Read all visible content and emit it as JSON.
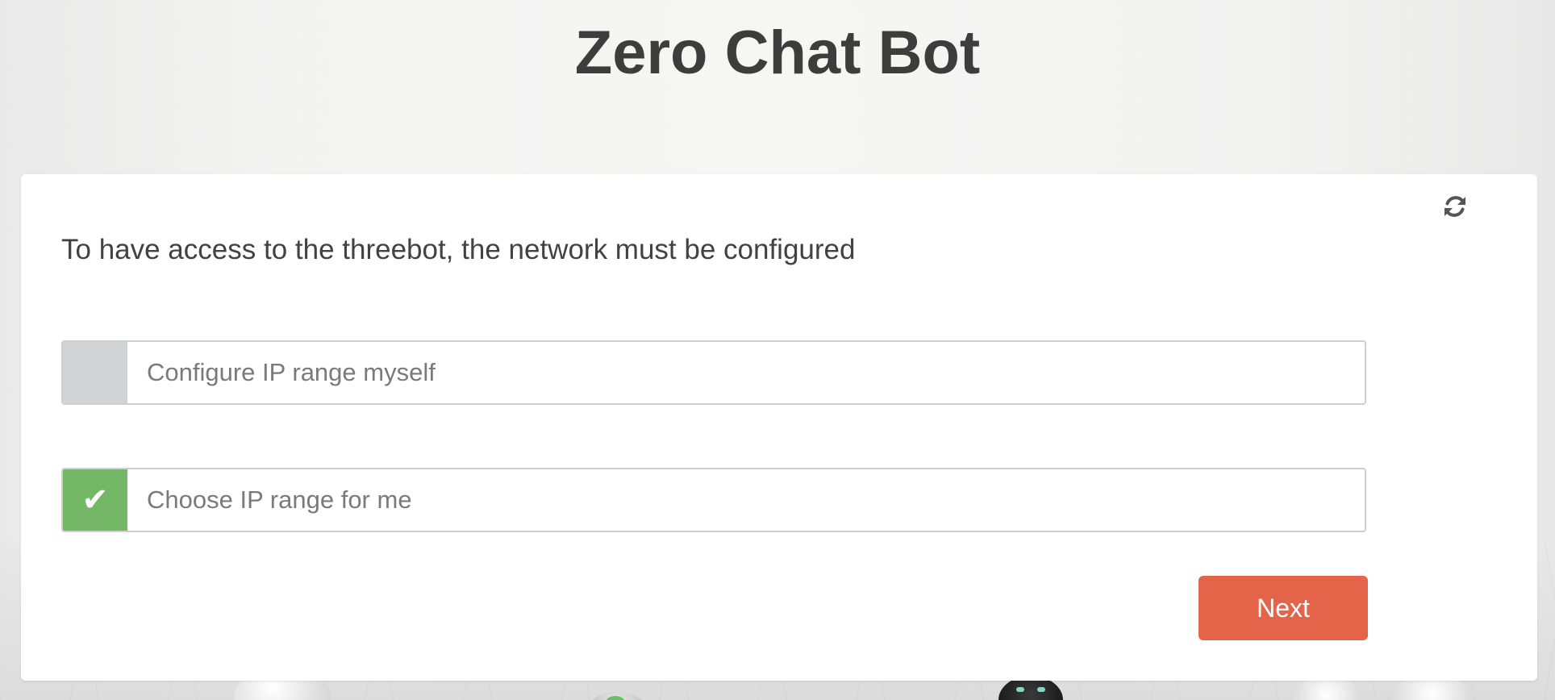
{
  "page": {
    "title": "Zero Chat Bot"
  },
  "card": {
    "question": "To have access to the threebot, the network must be configured",
    "refresh_icon": "refresh-icon",
    "options": [
      {
        "label": "Configure IP range myself",
        "checked": false
      },
      {
        "label": "Choose IP range for me",
        "checked": true,
        "check_glyph": "✔"
      }
    ],
    "next_label": "Next"
  },
  "colors": {
    "accent": "#e4644a",
    "checked": "#74b766",
    "unchecked": "#d2d3d6",
    "title": "#3d3d3d"
  }
}
